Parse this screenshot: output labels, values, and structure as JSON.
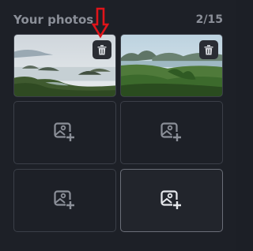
{
  "gallery": {
    "title": "Your photos",
    "counter": "2/15",
    "photos": [
      {
        "name": "Coastal islands landscape",
        "icon": "trash-icon"
      },
      {
        "name": "Mountain valley landscape",
        "icon": "trash-icon"
      }
    ],
    "empty_slots": [
      {
        "icon": "add-image-icon"
      },
      {
        "icon": "add-image-icon"
      },
      {
        "icon": "add-image-icon"
      },
      {
        "icon": "add-image-icon",
        "highlighted": true
      }
    ]
  },
  "annotation": {
    "icon": "red-down-arrow-icon",
    "color": "#e0141a"
  },
  "colors": {
    "background": "#1d2027",
    "tile_border": "#3b3f48",
    "icon": "#8b8f98"
  }
}
